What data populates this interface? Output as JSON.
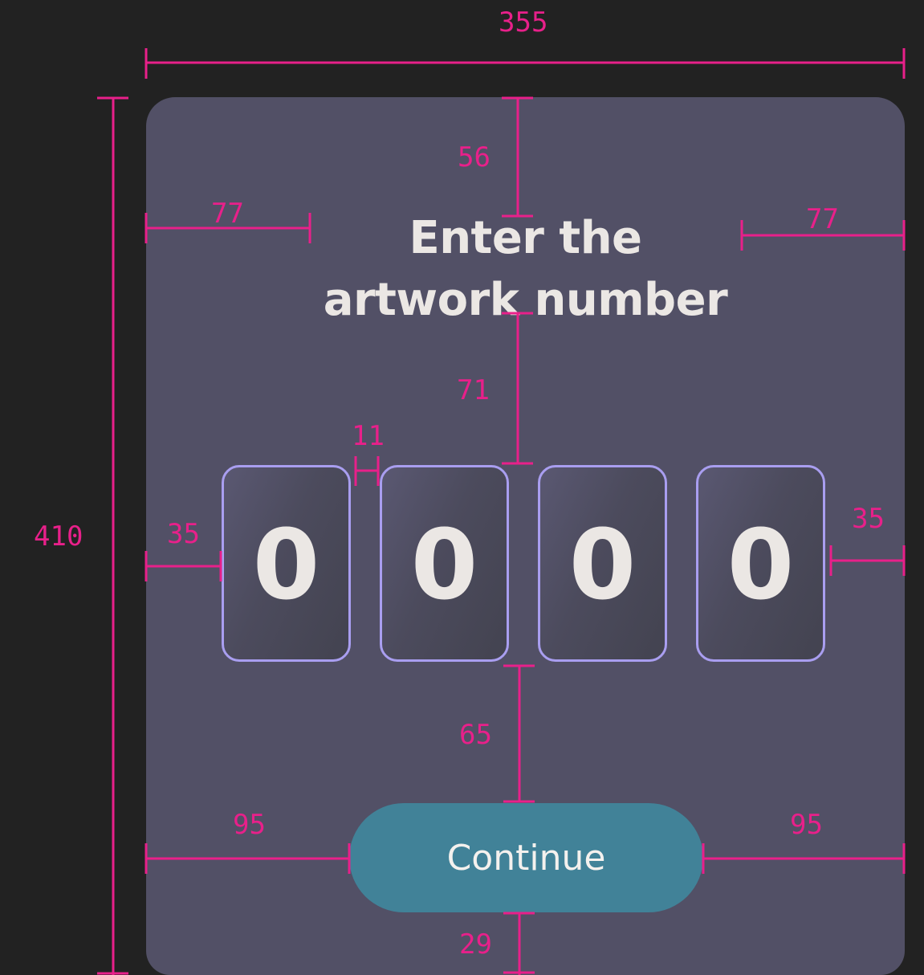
{
  "card": {
    "title": "Enter the artwork number",
    "digits": [
      "0",
      "0",
      "0",
      "0"
    ],
    "continue_label": "Continue"
  },
  "colors": {
    "page_background": "#222222",
    "card_background": "#525066",
    "digit_border": "#a99ef0",
    "button_background": "#418298",
    "text": "#ebe7e4",
    "redline": "#e8208a"
  },
  "annotations": {
    "card_width": "355",
    "card_height": "410",
    "title_top": "56",
    "title_left": "77",
    "title_right": "77",
    "title_to_digits": "71",
    "digit_gap": "11",
    "digits_left": "35",
    "digits_right": "35",
    "digits_to_button": "65",
    "button_left": "95",
    "button_right": "95",
    "button_bottom": "29"
  }
}
